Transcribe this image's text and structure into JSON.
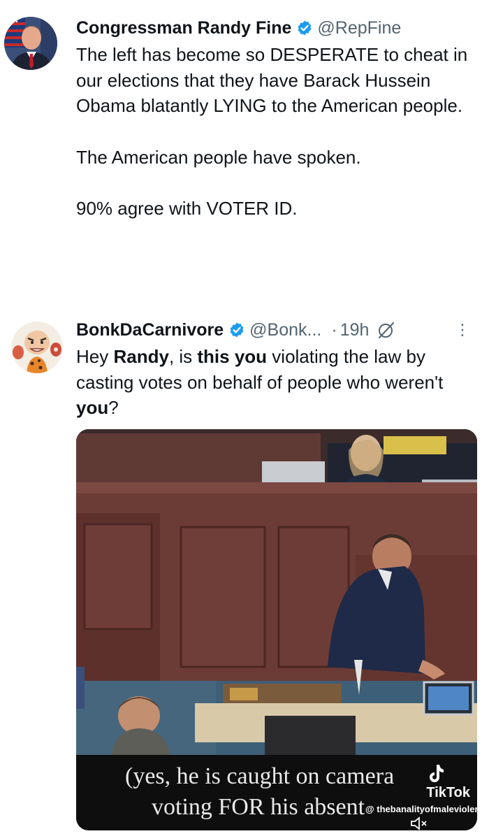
{
  "tweet1": {
    "name": "Congressman Randy Fine",
    "handle": "@RepFine",
    "paragraphs": [
      "The left has become so DESPERATE to cheat in our elections that they have Barack Hussein Obama blatantly LYING to the American people.",
      "The American people have spoken.",
      "90% agree with VOTER ID."
    ]
  },
  "tweet2": {
    "name": "BonkDaCarnivore",
    "handle": "@Bonk...",
    "dot": "·",
    "time": "19h",
    "more": "⋮",
    "body": {
      "t1": "Hey ",
      "b1": "Randy",
      "t2": ", is ",
      "b2": "this you",
      "t3": " violating the law by casting votes on behalf of people who weren't ",
      "b3": "you",
      "t4": "?"
    },
    "video": {
      "caption_line1": "(yes, he is caught on camera",
      "caption_line2": "voting FOR his absent",
      "tiktok_label": "TikTok",
      "tiktok_user": "@ thebanalityofmaleviolence"
    }
  },
  "colors": {
    "verified": "#1d9bf0",
    "secondary_text": "#536471",
    "chamber_wood": "#6b3b35",
    "carpet": "#3d5f78"
  }
}
